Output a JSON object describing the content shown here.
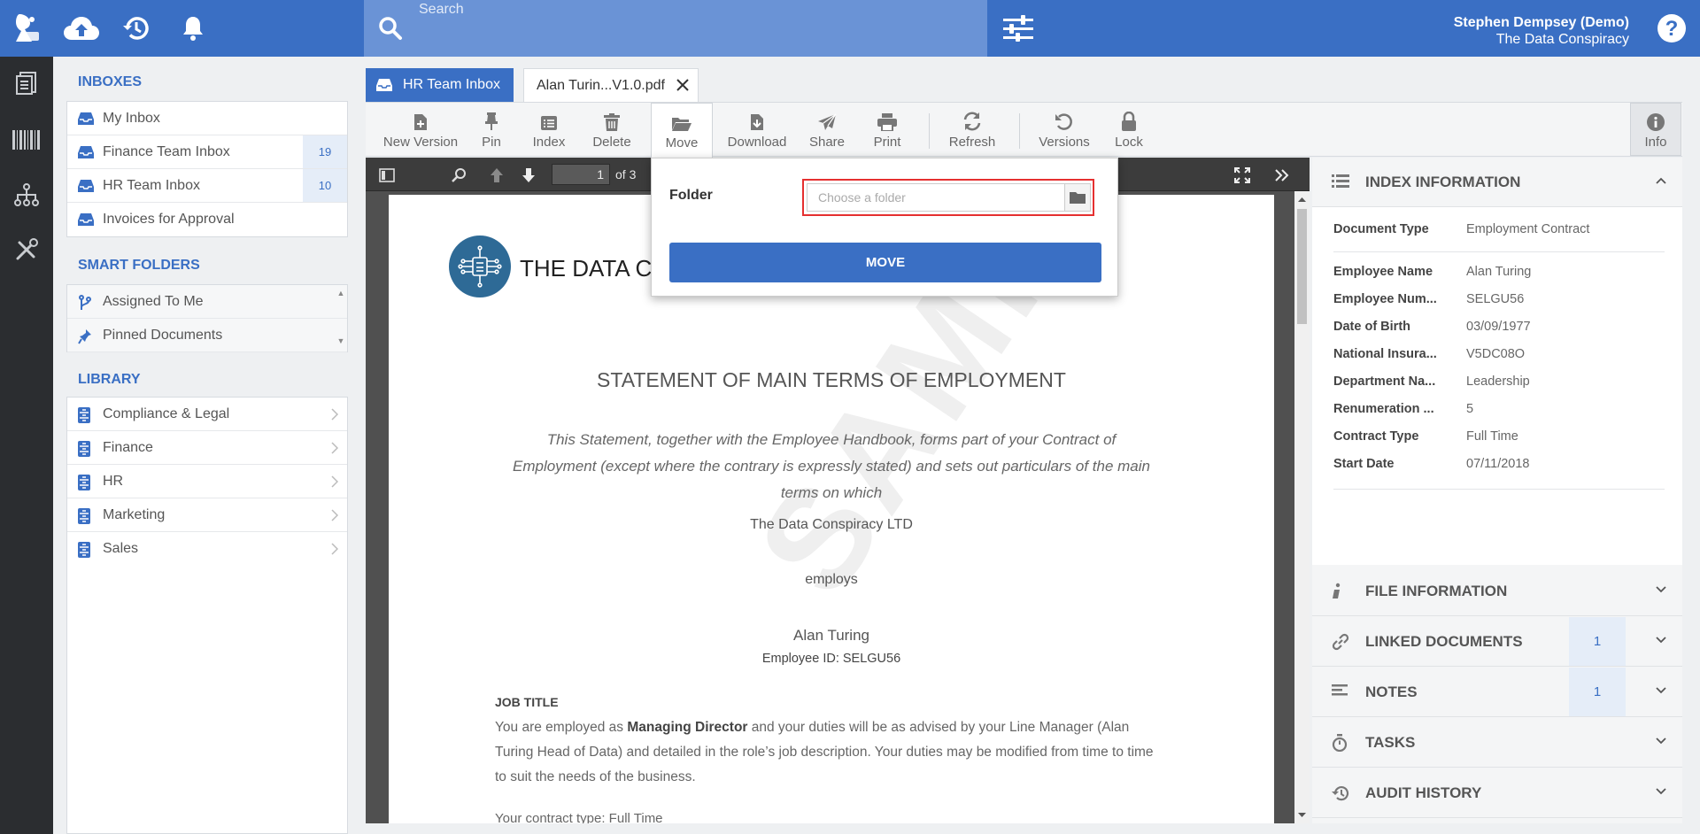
{
  "topbar": {
    "search_placeholder": "Search",
    "user_name": "Stephen Dempsey (Demo)",
    "user_org": "The Data Conspiracy"
  },
  "sidebar": {
    "inboxes_title": "INBOXES",
    "inboxes": [
      {
        "label": "My Inbox",
        "count": ""
      },
      {
        "label": "Finance Team Inbox",
        "count": "19"
      },
      {
        "label": "HR Team Inbox",
        "count": "10"
      },
      {
        "label": "Invoices for Approval",
        "count": ""
      }
    ],
    "smart_title": "SMART FOLDERS",
    "smart": [
      {
        "label": "Assigned To Me"
      },
      {
        "label": "Pinned Documents"
      }
    ],
    "library_title": "LIBRARY",
    "library": [
      {
        "label": "Compliance & Legal"
      },
      {
        "label": "Finance"
      },
      {
        "label": "HR"
      },
      {
        "label": "Marketing"
      },
      {
        "label": "Sales"
      }
    ]
  },
  "tabs": {
    "inbox": "HR Team Inbox",
    "doc": "Alan Turin...V1.0.pdf"
  },
  "toolbar": {
    "new_version": "New Version",
    "pin": "Pin",
    "index": "Index",
    "delete": "Delete",
    "move": "Move",
    "download": "Download",
    "share": "Share",
    "print": "Print",
    "refresh": "Refresh",
    "versions": "Versions",
    "lock": "Lock",
    "info": "Info"
  },
  "viewer": {
    "page_number": "1",
    "page_of": "of 3"
  },
  "document": {
    "company": "THE DATA CO",
    "title": "STATEMENT OF MAIN TERMS OF EMPLOYMENT",
    "intro": "This Statement, together with the Employee Handbook, forms part of your Contract of Employment (except where the contrary is expressly stated) and sets out particulars of the main terms on which",
    "employer": "The Data Conspiracy LTD",
    "employs": "employs",
    "employee": "Alan Turing",
    "employee_id": "Employee ID: SELGU56",
    "job_title_heading": "JOB TITLE",
    "job_para_1": "You are employed as ",
    "job_role": "Managing Director",
    "job_para_2": " and your duties will be as advised by your Line Manager (Alan Turing Head of Data) and detailed in the role’s job description. Your duties may be modified from time to time to suit the needs of the business.",
    "contract_type_line": "Your contract type: Full Time",
    "watermark": "SAMPLE DATA"
  },
  "move_popup": {
    "folder_label": "Folder",
    "folder_placeholder": "Choose a folder",
    "move_button": "MOVE"
  },
  "info_panel": {
    "index_title": "INDEX INFORMATION",
    "fields": [
      {
        "key": "Document Type",
        "value": "Employment Contract"
      },
      {
        "key": "Employee Name",
        "value": "Alan Turing"
      },
      {
        "key": "Employee Num...",
        "value": "SELGU56"
      },
      {
        "key": "Date of Birth",
        "value": "03/09/1977"
      },
      {
        "key": "National Insura...",
        "value": "V5DC08O"
      },
      {
        "key": "Department Na...",
        "value": "Leadership"
      },
      {
        "key": "Renumeration ...",
        "value": "5"
      },
      {
        "key": "Contract Type",
        "value": "Full Time"
      },
      {
        "key": "Start Date",
        "value": "07/11/2018"
      }
    ],
    "file_info_title": "FILE INFORMATION",
    "linked_title": "LINKED DOCUMENTS",
    "linked_count": "1",
    "notes_title": "NOTES",
    "notes_count": "1",
    "tasks_title": "TASKS",
    "audit_title": "AUDIT HISTORY"
  },
  "colors": {
    "brand_blue": "#3a6fc4",
    "highlight_red": "#e53030",
    "rail_dark": "#2b2d30"
  }
}
